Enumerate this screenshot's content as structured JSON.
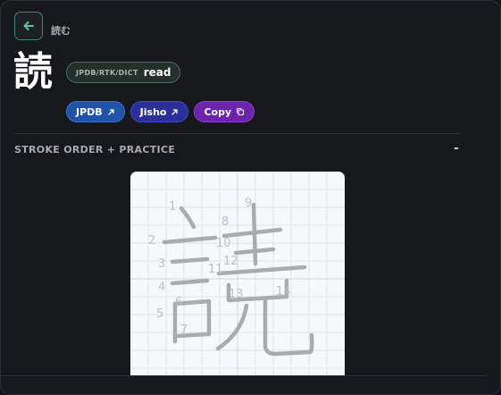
{
  "header": {
    "back_icon": "arrow-left-icon",
    "breadcrumb": "読む"
  },
  "kanji": {
    "character": "読",
    "meaning_source": "JPDB/RTK/DICT",
    "meaning": "read"
  },
  "links": {
    "jpdb_label": "JPDB",
    "jisho_label": "Jisho",
    "copy_label": "Copy",
    "external_icon": "external-link-icon",
    "copy_icon": "copy-icon"
  },
  "stroke_section": {
    "title": "STROKE ORDER + PRACTICE",
    "collapse_label": "-",
    "stroke_numbers": [
      "1",
      "2",
      "3",
      "4",
      "5",
      "6",
      "7",
      "8",
      "9",
      "10",
      "11",
      "12",
      "13",
      "14"
    ]
  },
  "colors": {
    "accent_green": "#3e8a68",
    "jpdb_blue": "#2153a6",
    "jisho_indigo": "#2b2f9a",
    "copy_purple": "#6b24ab",
    "stroke_gray": "#a9abae"
  }
}
